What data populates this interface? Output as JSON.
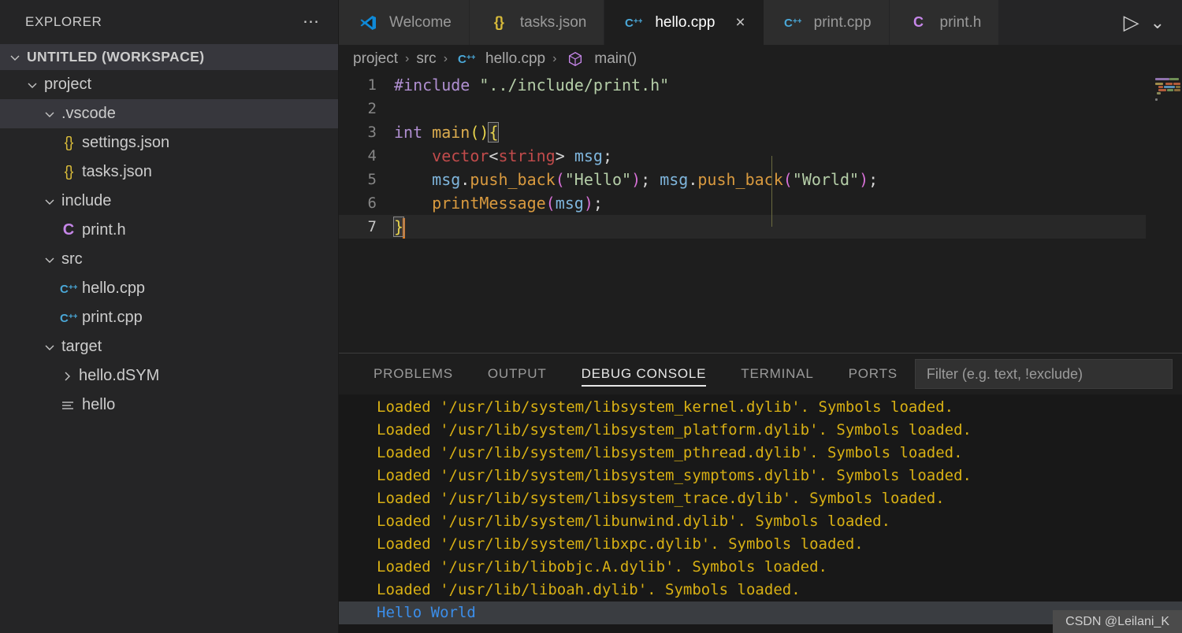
{
  "sidebar": {
    "header": {
      "title": "EXPLORER",
      "more_icon": "ellipsis-icon"
    },
    "workspace": {
      "label": "UNTITLED (WORKSPACE)"
    },
    "tree": [
      {
        "label": "project",
        "type": "folder",
        "expanded": true,
        "indent": 1,
        "icon": "chevron-down-icon",
        "selected": false
      },
      {
        "label": ".vscode",
        "type": "folder",
        "expanded": true,
        "indent": 2,
        "icon": "chevron-down-icon",
        "selected": true
      },
      {
        "label": "settings.json",
        "type": "file",
        "indent": 3,
        "icon": "json-icon",
        "selected": false
      },
      {
        "label": "tasks.json",
        "type": "file",
        "indent": 3,
        "icon": "json-icon",
        "selected": false
      },
      {
        "label": "include",
        "type": "folder",
        "expanded": true,
        "indent": 2,
        "icon": "chevron-down-icon",
        "selected": false
      },
      {
        "label": "print.h",
        "type": "file",
        "indent": 3,
        "icon": "c-header-icon",
        "selected": false
      },
      {
        "label": "src",
        "type": "folder",
        "expanded": true,
        "indent": 2,
        "icon": "chevron-down-icon",
        "selected": false
      },
      {
        "label": "hello.cpp",
        "type": "file",
        "indent": 3,
        "icon": "cpp-icon",
        "selected": false
      },
      {
        "label": "print.cpp",
        "type": "file",
        "indent": 3,
        "icon": "cpp-icon",
        "selected": false
      },
      {
        "label": "target",
        "type": "folder",
        "expanded": true,
        "indent": 2,
        "icon": "chevron-down-icon",
        "selected": false
      },
      {
        "label": "hello.dSYM",
        "type": "folder",
        "expanded": false,
        "indent": 3,
        "icon": "chevron-right-icon",
        "selected": false
      },
      {
        "label": "hello",
        "type": "file",
        "indent": 3,
        "icon": "binary-icon",
        "selected": false
      }
    ]
  },
  "tabs": [
    {
      "label": "Welcome",
      "icon": "vscode-logo-icon",
      "active": false,
      "closable": false
    },
    {
      "label": "tasks.json",
      "icon": "json-icon",
      "active": false,
      "closable": false
    },
    {
      "label": "hello.cpp",
      "icon": "cpp-icon",
      "active": true,
      "closable": true,
      "close_glyph": "×"
    },
    {
      "label": "print.cpp",
      "icon": "cpp-icon",
      "active": false,
      "closable": false
    },
    {
      "label": "print.h",
      "icon": "c-header-icon",
      "active": false,
      "closable": false
    }
  ],
  "tab_actions": [
    {
      "name": "run-button",
      "glyph": "▷"
    },
    {
      "name": "chevron-down-button",
      "glyph": "⌄"
    }
  ],
  "breadcrumb": {
    "separator": "›",
    "items": [
      {
        "label": "project",
        "icon": null
      },
      {
        "label": "src",
        "icon": null
      },
      {
        "label": "hello.cpp",
        "icon": "cpp-icon"
      },
      {
        "label": "main()",
        "icon": "symbol-method-icon"
      }
    ]
  },
  "editor": {
    "language": "cpp",
    "current_line": 7,
    "lines": [
      {
        "no": "1",
        "tokens": [
          {
            "t": "#include ",
            "c": "t-pre"
          },
          {
            "t": "\"../include/print.h\"",
            "c": "t-str"
          }
        ]
      },
      {
        "no": "2",
        "tokens": []
      },
      {
        "no": "3",
        "tokens": [
          {
            "t": "int ",
            "c": "t-key"
          },
          {
            "t": "main",
            "c": "t-fn"
          },
          {
            "t": "()",
            "c": "t-paren-y"
          },
          {
            "t": "{",
            "c": "t-paren-y brace-box"
          }
        ]
      },
      {
        "no": "4",
        "indent": true,
        "tokens": [
          {
            "t": "    ",
            "c": "t-plain"
          },
          {
            "t": "vector",
            "c": "t-type"
          },
          {
            "t": "<",
            "c": "t-op"
          },
          {
            "t": "string",
            "c": "t-type"
          },
          {
            "t": "> ",
            "c": "t-op"
          },
          {
            "t": "msg",
            "c": "t-var"
          },
          {
            "t": ";",
            "c": "t-plain"
          }
        ]
      },
      {
        "no": "5",
        "indent": true,
        "tokens": [
          {
            "t": "    ",
            "c": "t-plain"
          },
          {
            "t": "msg",
            "c": "t-var"
          },
          {
            "t": ".",
            "c": "t-plain"
          },
          {
            "t": "push_back",
            "c": "t-fn2"
          },
          {
            "t": "(",
            "c": "t-paren-m"
          },
          {
            "t": "\"Hello\"",
            "c": "t-strlit"
          },
          {
            "t": ")",
            "c": "t-paren-m"
          },
          {
            "t": "; ",
            "c": "t-plain"
          },
          {
            "t": "msg",
            "c": "t-var"
          },
          {
            "t": ".",
            "c": "t-plain"
          },
          {
            "t": "push_back",
            "c": "t-fn2"
          },
          {
            "t": "(",
            "c": "t-paren-m"
          },
          {
            "t": "\"World\"",
            "c": "t-strlit"
          },
          {
            "t": ")",
            "c": "t-paren-m"
          },
          {
            "t": ";",
            "c": "t-plain"
          }
        ]
      },
      {
        "no": "6",
        "indent": true,
        "tokens": [
          {
            "t": "    ",
            "c": "t-plain"
          },
          {
            "t": "printMessage",
            "c": "t-fn2"
          },
          {
            "t": "(",
            "c": "t-paren-m"
          },
          {
            "t": "msg",
            "c": "t-var"
          },
          {
            "t": ")",
            "c": "t-paren-m"
          },
          {
            "t": ";",
            "c": "t-plain"
          }
        ]
      },
      {
        "no": "7",
        "tokens": [
          {
            "t": "}",
            "c": "t-paren-y brace-box"
          }
        ],
        "cursor": true
      }
    ]
  },
  "panel": {
    "tabs": [
      {
        "label": "PROBLEMS",
        "active": false
      },
      {
        "label": "OUTPUT",
        "active": false
      },
      {
        "label": "DEBUG CONSOLE",
        "active": true
      },
      {
        "label": "TERMINAL",
        "active": false
      },
      {
        "label": "PORTS",
        "active": false
      }
    ],
    "filter": {
      "value": "",
      "placeholder": "Filter (e.g. text, !exclude)"
    },
    "console_lines": [
      {
        "text": "Loaded '/usr/lib/system/libsystem_kernel.dylib'. Symbols loaded.",
        "kind": "log"
      },
      {
        "text": "Loaded '/usr/lib/system/libsystem_platform.dylib'. Symbols loaded.",
        "kind": "log"
      },
      {
        "text": "Loaded '/usr/lib/system/libsystem_pthread.dylib'. Symbols loaded.",
        "kind": "log"
      },
      {
        "text": "Loaded '/usr/lib/system/libsystem_symptoms.dylib'. Symbols loaded.",
        "kind": "log"
      },
      {
        "text": "Loaded '/usr/lib/system/libsystem_trace.dylib'. Symbols loaded.",
        "kind": "log"
      },
      {
        "text": "Loaded '/usr/lib/system/libunwind.dylib'. Symbols loaded.",
        "kind": "log"
      },
      {
        "text": "Loaded '/usr/lib/system/libxpc.dylib'. Symbols loaded.",
        "kind": "log"
      },
      {
        "text": "Loaded '/usr/lib/libobjc.A.dylib'. Symbols loaded.",
        "kind": "log"
      },
      {
        "text": "Loaded '/usr/lib/liboah.dylib'. Symbols loaded.",
        "kind": "log"
      },
      {
        "text": "Hello World",
        "kind": "output"
      }
    ]
  },
  "watermark": {
    "text": "CSDN @Leilani_K"
  },
  "colors": {
    "sidebar_bg": "#252526",
    "editor_bg": "#1e1e1e",
    "tab_inactive_bg": "#2d2d2d",
    "selection_bg": "#37373d",
    "console_bg": "#181818",
    "log_text": "#d8b014",
    "output_text": "#3b8eea",
    "accent": "#e7e7e7"
  }
}
